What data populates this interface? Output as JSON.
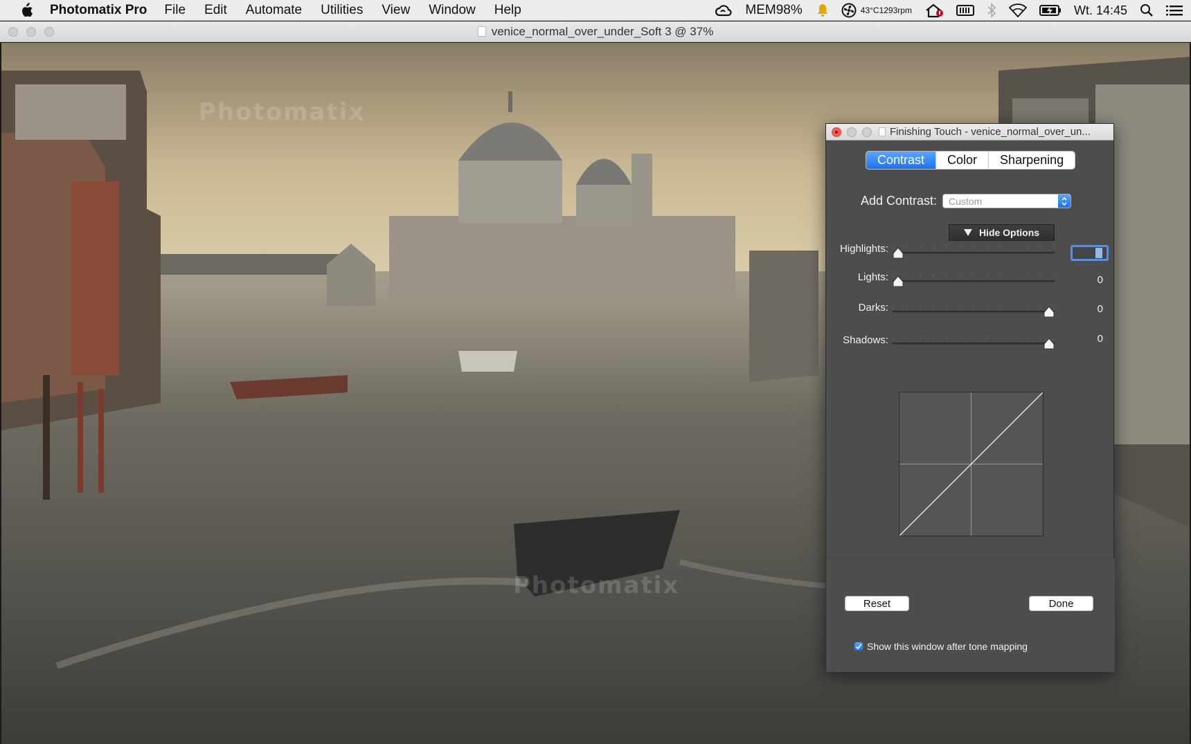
{
  "menubar": {
    "app_name": "Photomatix Pro",
    "items": [
      "File",
      "Edit",
      "Automate",
      "Utilities",
      "View",
      "Window",
      "Help"
    ],
    "status": {
      "mem_label": "MEM",
      "mem_value": "98%",
      "temp": "43°C",
      "rpm": "1293rpm",
      "clock": "Wt. 14:45"
    },
    "icons": [
      "apple-icon",
      "creative-cloud-icon",
      "notification-bell-icon",
      "fan-icon",
      "home-icon",
      "battery-meter-icon",
      "bluetooth-icon",
      "wifi-icon",
      "battery-icon",
      "search-icon",
      "list-icon"
    ]
  },
  "document": {
    "title": "venice_normal_over_under_Soft 3 @ 37%",
    "watermark": "Photomatix"
  },
  "panel": {
    "title": "Finishing Touch - venice_normal_over_un...",
    "tabs": [
      "Contrast",
      "Color",
      "Sharpening"
    ],
    "active_tab": "Contrast",
    "add_contrast_label": "Add Contrast:",
    "add_contrast_value": "Custom",
    "hide_options_label": "Hide Options",
    "sliders": [
      {
        "label": "Highlights:",
        "value": "0",
        "position": 0.0
      },
      {
        "label": "Lights:",
        "value": "0",
        "position": 0.0
      },
      {
        "label": "Darks:",
        "value": "0",
        "position": 1.0
      },
      {
        "label": "Shadows:",
        "value": "0",
        "position": 1.0
      }
    ],
    "reset_label": "Reset",
    "done_label": "Done",
    "show_window_label": "Show this window after tone mapping",
    "show_window_checked": true
  }
}
